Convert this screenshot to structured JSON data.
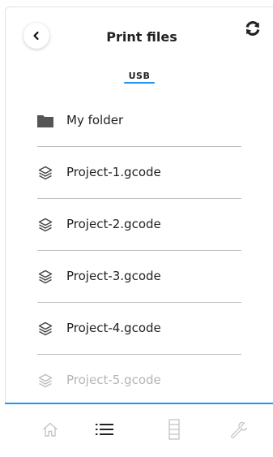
{
  "header": {
    "title": "Print files",
    "back_icon": "chevron-left-icon",
    "refresh_icon": "refresh-icon"
  },
  "tabs": [
    {
      "label": "USB",
      "active": true
    }
  ],
  "files": [
    {
      "name": "My folder",
      "type": "folder",
      "icon": "folder-icon"
    },
    {
      "name": "Project-1.gcode",
      "type": "file",
      "icon": "layers-icon"
    },
    {
      "name": "Project-2.gcode",
      "type": "file",
      "icon": "layers-icon"
    },
    {
      "name": "Project-3.gcode",
      "type": "file",
      "icon": "layers-icon"
    },
    {
      "name": "Project-4.gcode",
      "type": "file",
      "icon": "layers-icon"
    },
    {
      "name": "Project-5.gcode",
      "type": "file",
      "icon": "layers-icon"
    }
  ],
  "bottom_nav": [
    {
      "name": "home",
      "icon": "home-icon",
      "active": false
    },
    {
      "name": "files",
      "icon": "list-icon",
      "active": true
    },
    {
      "name": "filament",
      "icon": "filament-icon",
      "active": false
    },
    {
      "name": "tools",
      "icon": "wrench-icon",
      "active": false
    }
  ],
  "colors": {
    "accent": "#2196f3",
    "text": "#222222",
    "divider": "#bdbdbd",
    "inactive_icon": "#c4c4c4"
  }
}
